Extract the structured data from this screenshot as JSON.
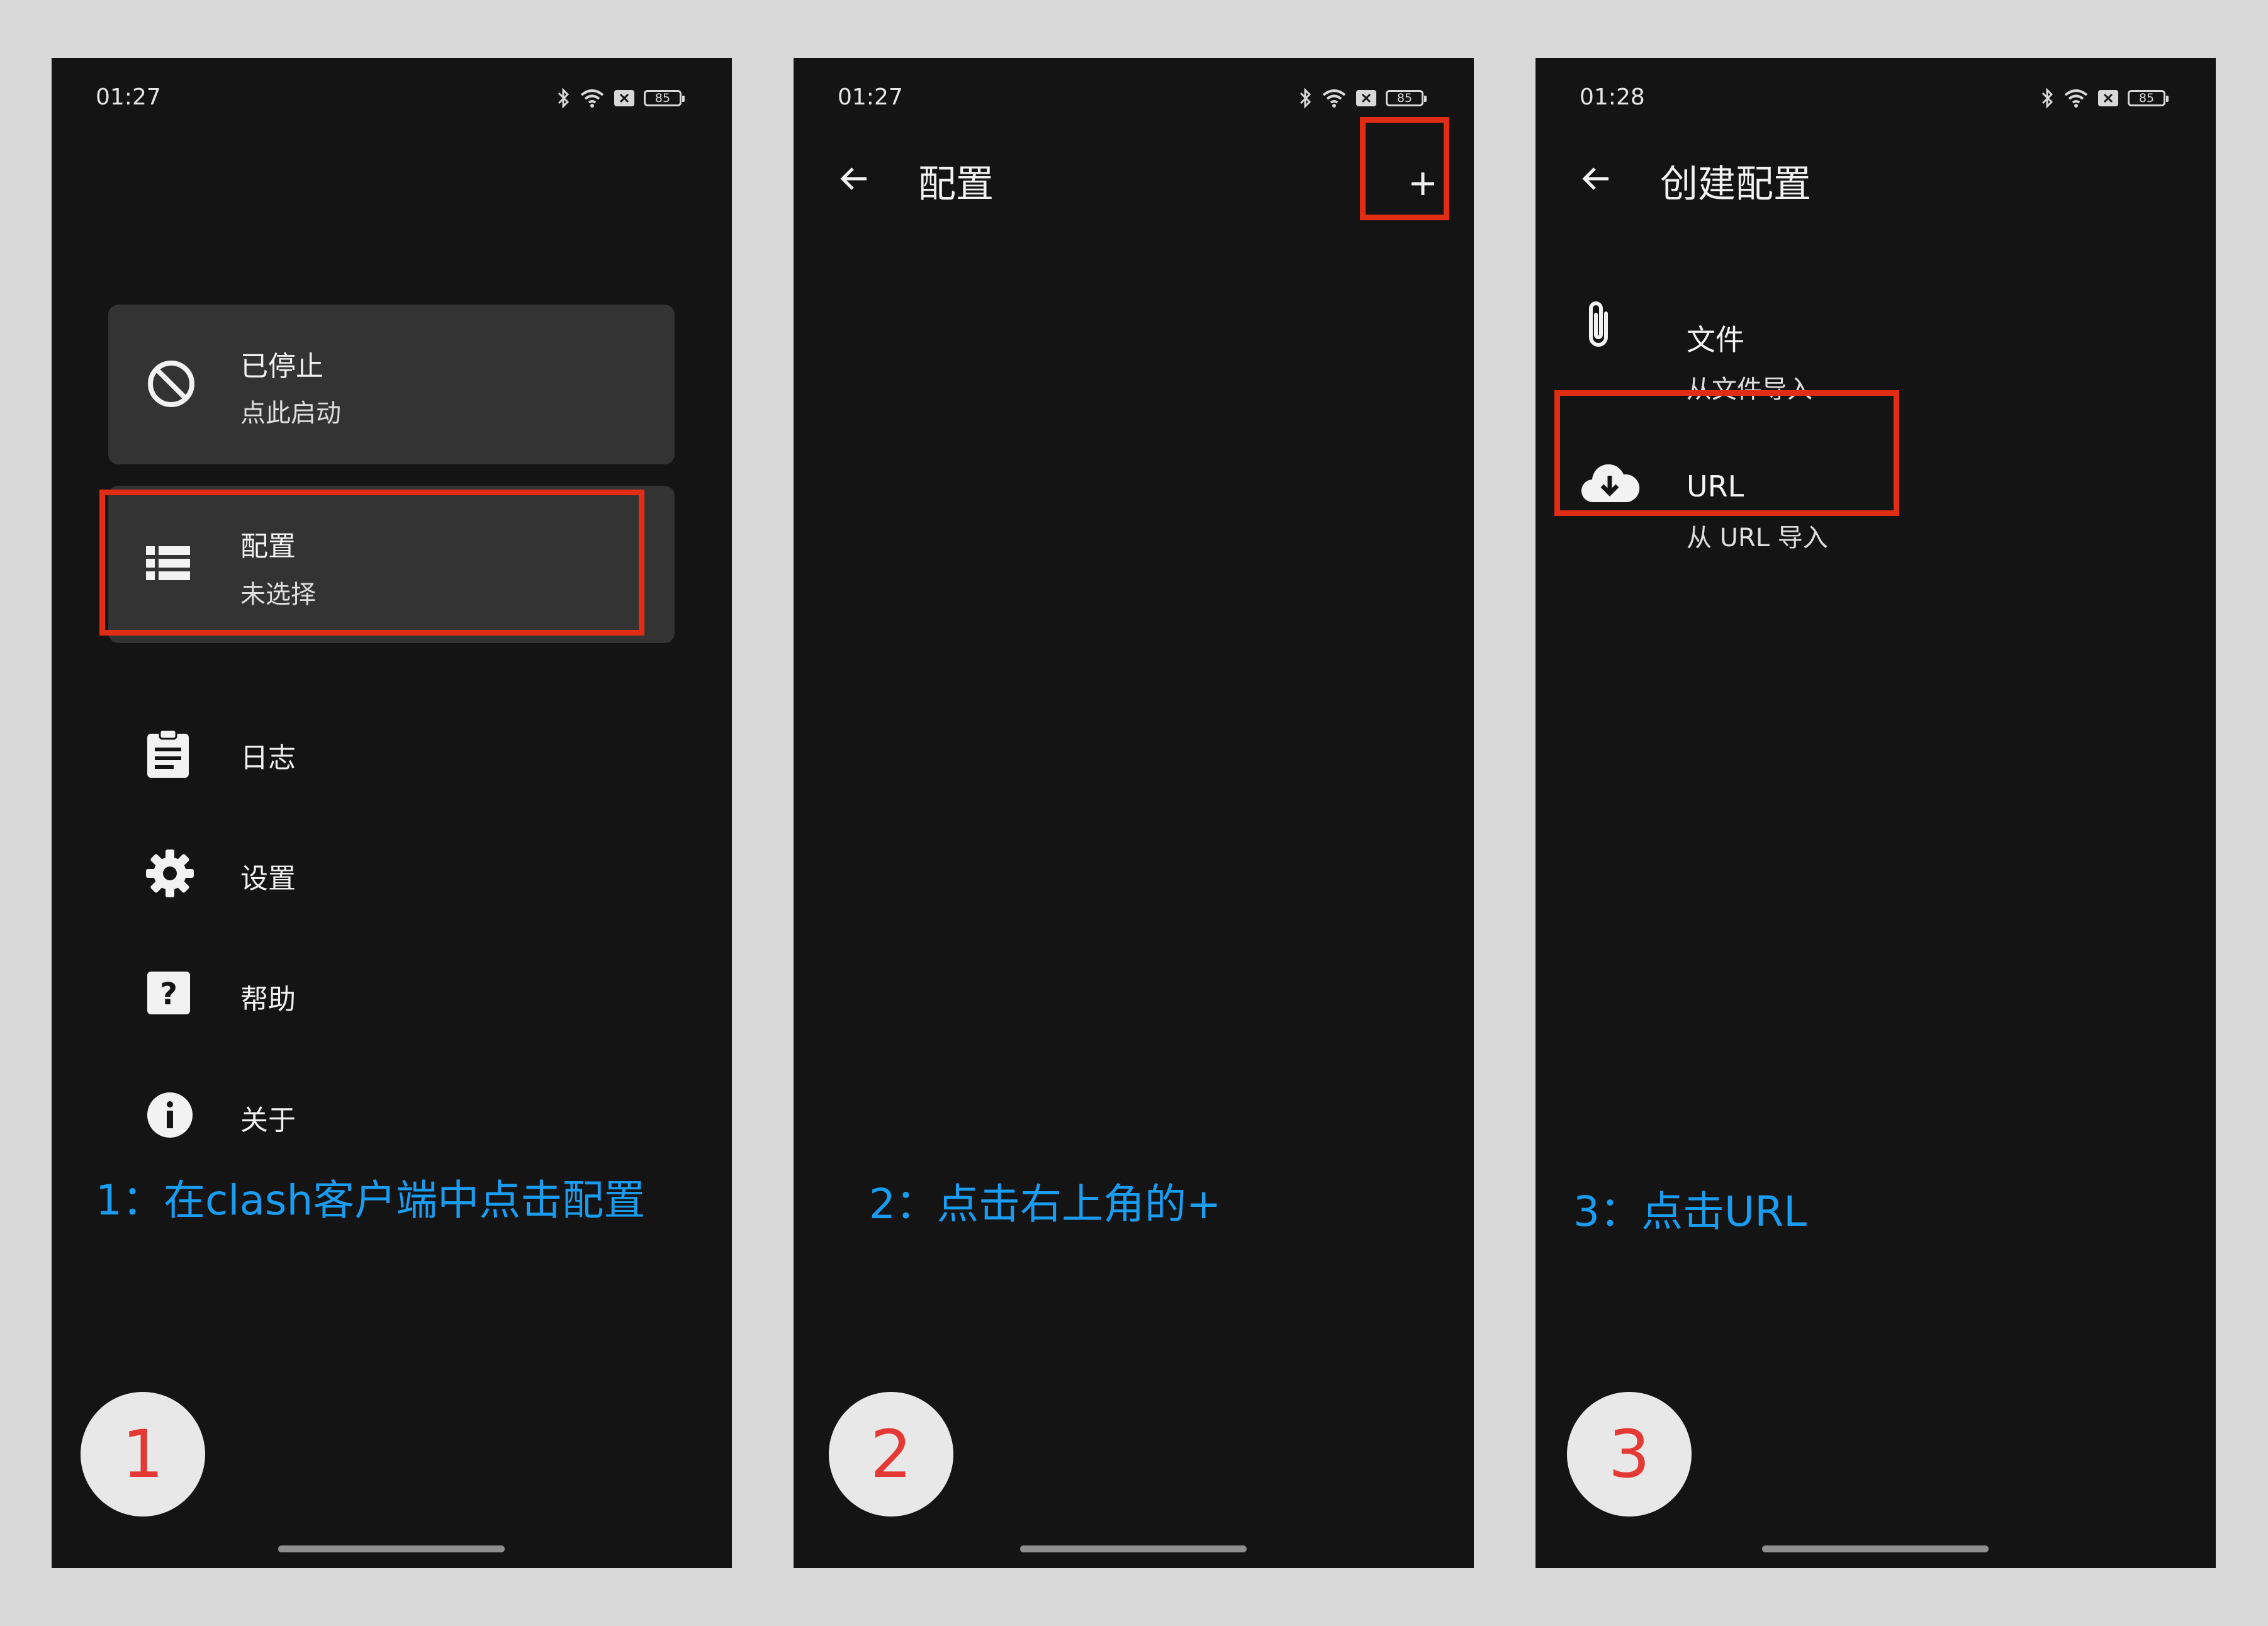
{
  "phones": [
    {
      "status": {
        "time": "01:27",
        "battery": "85"
      },
      "cards": [
        {
          "title": "已停止",
          "subtitle": "点此启动",
          "icon": "block-icon"
        },
        {
          "title": "配置",
          "subtitle": "未选择",
          "icon": "list-icon"
        }
      ],
      "menu": [
        {
          "label": "日志",
          "icon": "clipboard-icon"
        },
        {
          "label": "设置",
          "icon": "gear-icon"
        },
        {
          "label": "帮助",
          "icon": "help-icon"
        },
        {
          "label": "关于",
          "icon": "info-icon"
        }
      ],
      "caption": "1：在clash客户端中点击配置",
      "step": "1"
    },
    {
      "status": {
        "time": "01:27",
        "battery": "85"
      },
      "appbar": {
        "title": "配置",
        "action": "+"
      },
      "caption": "2：点击右上角的+",
      "step": "2"
    },
    {
      "status": {
        "time": "01:28",
        "battery": "85"
      },
      "appbar": {
        "title": "创建配置"
      },
      "options": [
        {
          "title": "文件",
          "subtitle": "从文件导入",
          "icon": "paperclip-icon"
        },
        {
          "title": "URL",
          "subtitle": "从 URL 导入",
          "icon": "cloud-download-icon"
        }
      ],
      "caption": "3：点击URL",
      "step": "3"
    }
  ],
  "colors": {
    "caption": "#1a9cf0",
    "highlight": "#e02d14",
    "step_number": "#e53935",
    "screen_bg": "#141414"
  }
}
